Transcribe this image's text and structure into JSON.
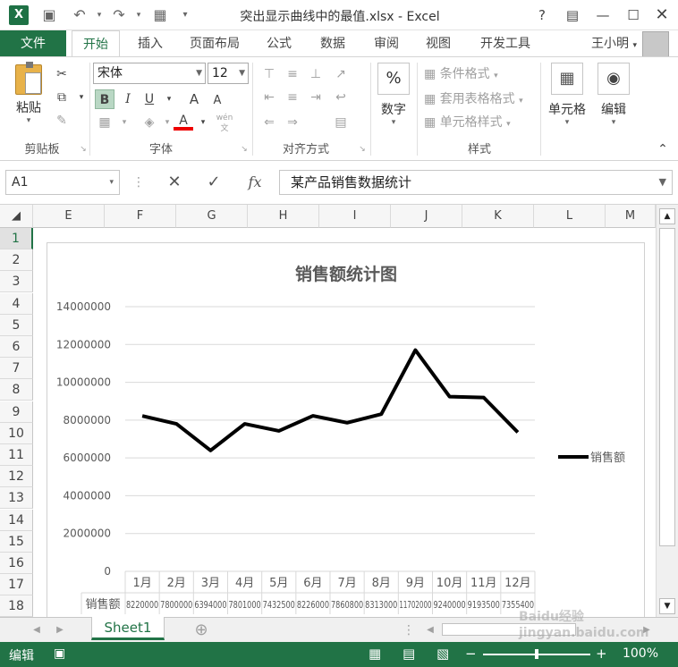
{
  "titlebar": {
    "title": "突出显示曲线中的最值.xlsx - Excel",
    "help": "?",
    "app_icon": "X",
    "save_icon": "save-icon",
    "undo_icon": "undo-icon",
    "redo_icon": "redo-icon"
  },
  "tabs": [
    "文件",
    "开始",
    "插入",
    "页面布局",
    "公式",
    "数据",
    "审阅",
    "视图",
    "开发工具"
  ],
  "user": "王小明",
  "ribbon": {
    "clipboard": {
      "paste": "粘贴",
      "label": "剪贴板"
    },
    "font": {
      "name": "宋体",
      "size": "12",
      "label": "字体",
      "bold": "B",
      "italic": "I",
      "underline": "U",
      "grow": "A",
      "shrink": "A",
      "color": "A",
      "wen": "wén"
    },
    "alignment": {
      "label": "对齐方式"
    },
    "number": {
      "label": "数字",
      "symbol": "%"
    },
    "styles": {
      "conditional": "条件格式",
      "table": "套用表格格式",
      "cell": "单元格样式",
      "label": "样式"
    },
    "cells": {
      "label": "单元格"
    },
    "editing": {
      "label": "编辑"
    }
  },
  "formula_bar": {
    "name_box": "A1",
    "content": "某产品销售数据统计",
    "fx": "fx"
  },
  "columns": [
    "E",
    "F",
    "G",
    "H",
    "I",
    "J",
    "K",
    "L",
    "M"
  ],
  "rows": [
    "1",
    "2",
    "3",
    "4",
    "5",
    "6",
    "7",
    "8",
    "9",
    "10",
    "11",
    "12",
    "13",
    "14",
    "15",
    "16",
    "17",
    "18"
  ],
  "chart_data": {
    "type": "line",
    "title": "销售额统计图",
    "categories": [
      "1月",
      "2月",
      "3月",
      "4月",
      "5月",
      "6月",
      "7月",
      "8月",
      "9月",
      "10月",
      "11月",
      "12月"
    ],
    "series": [
      {
        "name": "销售额",
        "values": [
          8220000,
          7800000,
          6394000,
          7801000,
          7432500,
          8226000,
          7860800,
          8313000,
          11702000,
          9240000,
          9193500,
          7355400
        ]
      }
    ],
    "table_row_label": "销售额",
    "table_values": [
      "8220000",
      "7800000",
      "6394000",
      "7801000",
      "7432500",
      "8226000",
      "7860800",
      "8313000",
      "11702000",
      "9240000",
      "9193500",
      "7355400"
    ],
    "ylim": [
      0,
      14000000
    ],
    "yticks": [
      "0",
      "2000000",
      "4000000",
      "6000000",
      "8000000",
      "10000000",
      "12000000",
      "14000000"
    ],
    "grid": true,
    "legend": "right",
    "line_color": "#000000"
  },
  "sheet_tabs": [
    "Sheet1"
  ],
  "status": {
    "mode": "编辑",
    "zoom": "100%"
  },
  "watermark": "Baidu经验 jingyan.baidu.com"
}
